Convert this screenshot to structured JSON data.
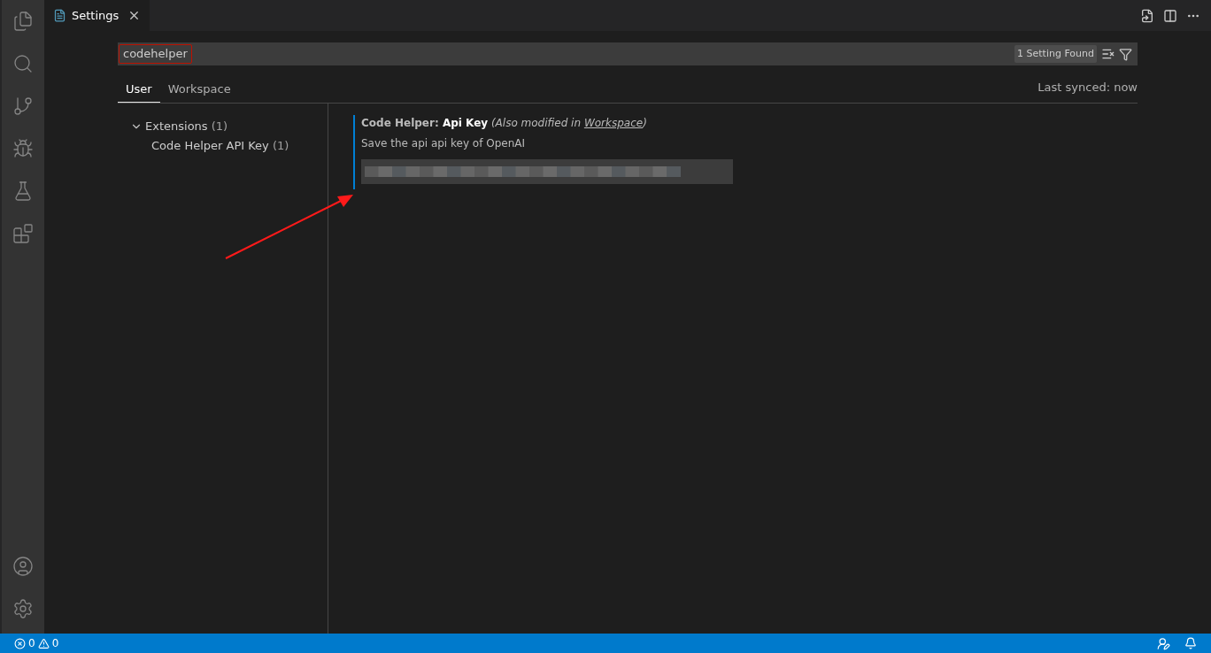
{
  "editor_tab": {
    "title": "Settings"
  },
  "search": {
    "value": "codehelper",
    "result_count": "1 Setting Found"
  },
  "scope_tabs": [
    {
      "label": "User",
      "selected": true
    },
    {
      "label": "Workspace",
      "selected": false
    }
  ],
  "sync_status": "Last synced: now",
  "toc": [
    {
      "label": "Extensions",
      "count": "(1)",
      "expanded": true,
      "children": [
        {
          "label": "Code Helper API Key",
          "count": "(1)"
        }
      ]
    }
  ],
  "setting": {
    "category": "Code Helper:",
    "name": "Api Key",
    "note_prefix": "(Also modified in ",
    "note_link": "Workspace",
    "note_suffix": ")",
    "description": "Save the api api key of OpenAI",
    "value_redacted": true
  },
  "status_bar": {
    "errors": "0",
    "warnings": "0"
  }
}
